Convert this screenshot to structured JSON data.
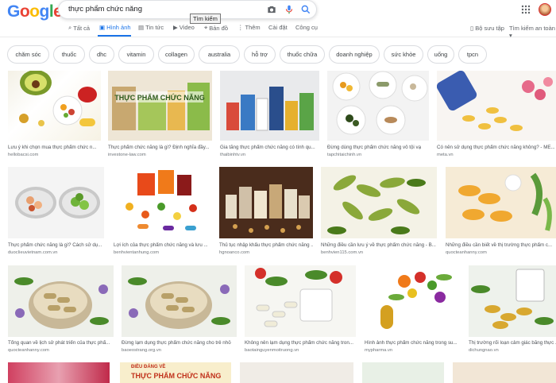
{
  "search": {
    "query": "thực phẩm chức năng",
    "tooltip": "Tìm kiếm"
  },
  "logo": [
    "G",
    "o",
    "o",
    "g",
    "l",
    "e"
  ],
  "logo_colors": [
    "#4285f4",
    "#ea4335",
    "#fbbc05",
    "#4285f4",
    "#34a853",
    "#ea4335"
  ],
  "tabs": [
    {
      "label": "Tất cả",
      "icon": "search-icon"
    },
    {
      "label": "Hình ảnh",
      "icon": "image-icon",
      "active": true
    },
    {
      "label": "Tin tức",
      "icon": "news-icon"
    },
    {
      "label": "Video",
      "icon": "video-icon"
    },
    {
      "label": "Bản đồ",
      "icon": "map-pin-icon"
    },
    {
      "label": "Thêm",
      "icon": "more-icon"
    },
    {
      "label": "Cài đặt"
    },
    {
      "label": "Công cụ"
    }
  ],
  "right_links": {
    "collections": "Bộ sưu tập",
    "safe_search": "Tìm kiếm an toàn ▾"
  },
  "chips": [
    "chăm sóc",
    "thuốc",
    "dhc",
    "vitamin",
    "collagen",
    "australia",
    "hỗ trợ",
    "thuốc chữa",
    "doanh nghiệp",
    "sức khỏe",
    "uống",
    "tpcn"
  ],
  "results": [
    {
      "title": "Lưu ý khi chọn mua thực phẩm chức n...",
      "source": "hellobacsi.com"
    },
    {
      "title": "Thực phẩm chức năng là gì? Định nghĩa đầy...",
      "source": "investone-law.com"
    },
    {
      "title": "Gia tăng thực phẩm chức năng có tính qu...",
      "source": "thaibinhtv.vn"
    },
    {
      "title": "Đừng dùng thực phẩm chức năng vô tội vạ",
      "source": "tapchitaichinh.vn"
    },
    {
      "title": "Có nên sử dụng thực phẩm chức năng không? - ME...",
      "source": "meta.vn"
    },
    {
      "title": "Thực phẩm chức năng là gì? Cách sử dụ...",
      "source": "duocIieuvietnam.com.vn"
    },
    {
      "title": "Lợi ích của thực phẩm chức năng và lưu ...",
      "source": "benhvientanhung.com"
    },
    {
      "title": "Thủ tục nhập khẩu thực phẩm chức năng ...",
      "source": "hgnoanco.com"
    },
    {
      "title": "Những điều cần lưu ý về thực phẩm chức năng - B...",
      "source": "benhvien115.com.vn"
    },
    {
      "title": "Những điều cần biết về thị trường thực phẩm c...",
      "source": "quocteanhanny.com"
    },
    {
      "title": "Tổng quan về lịch sử phát triển của thực phẩ...",
      "source": "quocteanhanny.com"
    },
    {
      "title": "Đừng lạm dụng thực phẩm chức năng cho trẻ nhỏ",
      "source": "baoeostrang.org.vn"
    },
    {
      "title": "Không nên lạm dụng thực phẩm chức năng tron...",
      "source": "baotainguyenmoitruong.vn"
    },
    {
      "title": "Hình ảnh thực phẩm chức năng trong su...",
      "source": "mypharma.vn"
    },
    {
      "title": "Thị trường rối loạn cảm giác bằng thực ...",
      "source": "dichungnao.vn"
    }
  ],
  "banner_text": {
    "line1": "ĐIỀU ĐÁNG VỀ",
    "line2": "THỰC PHẨM CHỨC NĂNG",
    "result2_banner": "THỰC PHẨM CHỨC NĂNG"
  }
}
